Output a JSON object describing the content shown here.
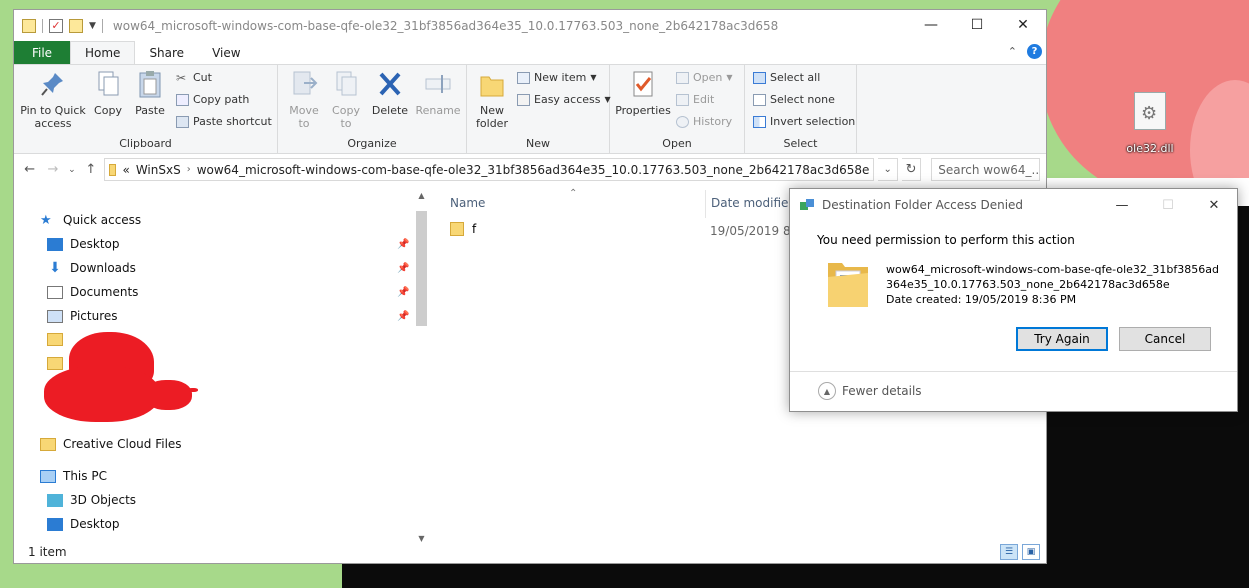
{
  "explorer": {
    "title": "wow64_microsoft-windows-com-base-qfe-ole32_31bf3856ad364e35_10.0.17763.503_none_2b642178ac3d658",
    "tabs": [
      "File",
      "Home",
      "Share",
      "View"
    ],
    "ribbon": {
      "clipboard": {
        "pin_label": "Pin to Quick access",
        "copy_label": "Copy",
        "paste_label": "Paste",
        "cut_label": "Cut",
        "copy_path_label": "Copy path",
        "paste_shortcut_label": "Paste shortcut",
        "group_label": "Clipboard"
      },
      "organize": {
        "move_to_label": "Move to",
        "copy_to_label": "Copy to",
        "delete_label": "Delete",
        "rename_label": "Rename",
        "group_label": "Organize"
      },
      "new": {
        "new_folder_label": "New folder",
        "new_item_label": "New item",
        "easy_access_label": "Easy access",
        "group_label": "New"
      },
      "open": {
        "properties_label": "Properties",
        "open_label": "Open",
        "edit_label": "Edit",
        "history_label": "History",
        "group_label": "Open"
      },
      "select": {
        "select_all_label": "Select all",
        "select_none_label": "Select none",
        "invert_selection_label": "Invert selection",
        "group_label": "Select"
      }
    },
    "address": {
      "overflow": "«",
      "crumb1": "WinSxS",
      "crumb2": "wow64_microsoft-windows-com-base-qfe-ole32_31bf3856ad364e35_10.0.17763.503_none_2b642178ac3d658e"
    },
    "search_placeholder": "Search wow64_...",
    "nav": {
      "quick_access": "Quick access",
      "desktop": "Desktop",
      "downloads": "Downloads",
      "documents": "Documents",
      "pictures": "Pictures",
      "creative_cloud": "Creative Cloud Files",
      "this_pc": "This PC",
      "objects_3d": "3D Objects",
      "desktop2": "Desktop"
    },
    "columns": {
      "name": "Name",
      "date_modified": "Date modified"
    },
    "files": [
      {
        "name": "f",
        "date": "19/05/2019 8:36"
      }
    ],
    "status": "1 item"
  },
  "dialog": {
    "title": "Destination Folder Access Denied",
    "message": "You need permission to perform this action",
    "folder_name_line1": "wow64_microsoft-windows-com-base-qfe-ole32_31bf3856ad",
    "folder_name_line2": "364e35_10.0.17763.503_none_2b642178ac3d658e",
    "date_created": "Date created: 19/05/2019 8:36 PM",
    "try_again_label": "Try Again",
    "cancel_label": "Cancel",
    "fewer_details_label": "Fewer details"
  },
  "desktop_file": {
    "name": "ole32.dll"
  },
  "colors": {
    "file_tab": "#1e7e34",
    "accent": "#0078d7",
    "redaction": "#ec1c24"
  }
}
